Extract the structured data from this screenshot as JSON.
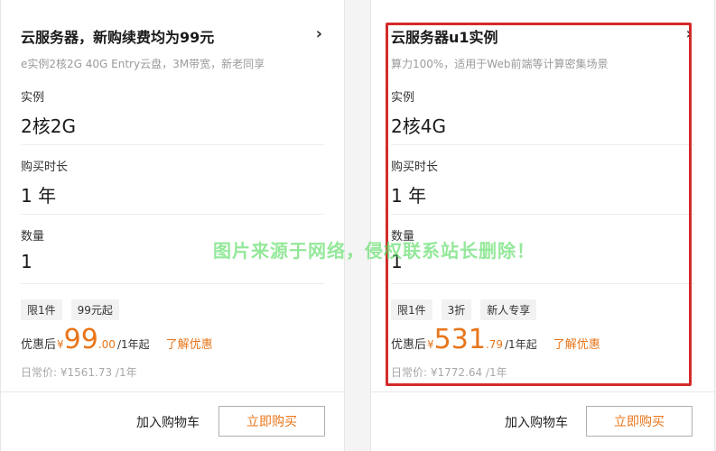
{
  "cards": [
    {
      "title": "云服务器，新购续费均为99元",
      "subtitle": "e实例2核2G 40G Entry云盘，3M带宽，新老同享",
      "instance_label": "实例",
      "instance_value": "2核2G",
      "duration_label": "购买时长",
      "duration_value": "1 年",
      "quantity_label": "数量",
      "quantity_value": "1",
      "tags": [
        "限1件",
        "99元起"
      ],
      "price_prefix": "优惠后",
      "currency": "¥",
      "price_int": "99",
      "price_dec": ".00",
      "price_suffix": "/1年起",
      "learn_more": "了解优惠",
      "original_price": "日常价: ¥1561.73 /1年",
      "add_to_cart": "加入购物车",
      "buy_now": "立即购买"
    },
    {
      "title": "云服务器u1实例",
      "subtitle": "算力100%，适用于Web前端等计算密集场景",
      "instance_label": "实例",
      "instance_value": "2核4G",
      "duration_label": "购买时长",
      "duration_value": "1 年",
      "quantity_label": "数量",
      "quantity_value": "1",
      "tags": [
        "限1件",
        "3折",
        "新人专享"
      ],
      "price_prefix": "优惠后",
      "currency": "¥",
      "price_int": "531",
      "price_dec": ".79",
      "price_suffix": "/1年起",
      "learn_more": "了解优惠",
      "original_price": "日常价: ¥1772.64 /1年",
      "add_to_cart": "加入购物车",
      "buy_now": "立即购买"
    }
  ],
  "watermark": "图片来源于网络，侵权联系站长删除！",
  "colors": {
    "accent": "#e8751a",
    "highlight": "#d42a2a",
    "watermark": "#5adc64"
  },
  "icons": {
    "chevron": "chevron-right-icon"
  }
}
